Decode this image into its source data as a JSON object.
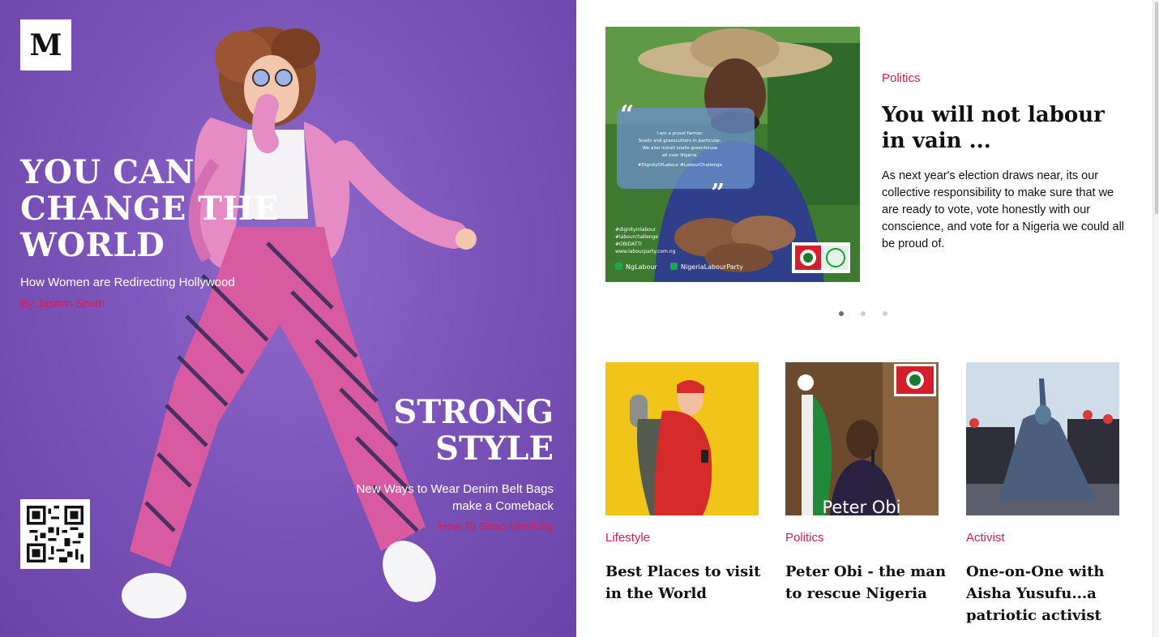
{
  "brand": {
    "logo_letter": "M"
  },
  "hero": {
    "headline_lines": [
      "YOU CAN",
      "CHANGE THE",
      "WORLD"
    ],
    "subheadline": "How Women are Redirecting Hollywood",
    "byline": "By Jasmin Smith",
    "secondary": {
      "title_lines": [
        "STRONG",
        "STYLE"
      ],
      "subheadline_lines": [
        "New Ways to Wear Denim Belt Bags",
        "make a Comeback"
      ],
      "link": "How To Shop Mindfully"
    }
  },
  "featured": {
    "category": "Politics",
    "title": "You will not labour in vain ...",
    "excerpt": "As next year's election draws near, its our collective responsibility to make sure that we are ready to vote, vote honestly with our conscience, and vote for a Nigeria we could all be proud of.",
    "image": {
      "quote_lines": [
        "I am a proud farmer.",
        "Snails and grasscutters in particular,",
        "We also install snails greenhouse",
        "all over Nigeria.",
        "#DignityOfLabour #LabourChallenge"
      ],
      "hashtags": [
        "#dignityinlabour",
        "#labourchallenge",
        "#OBIDATTI",
        "www.labourparty.com.ng"
      ],
      "social": [
        "NgLabour",
        "NigeriaLabourParty"
      ]
    }
  },
  "carousel": {
    "slide_count": 3,
    "active_index": 0
  },
  "cards": [
    {
      "category": "Lifestyle",
      "title": "Best Places to visit in the World"
    },
    {
      "category": "Politics",
      "title": "Peter Obi - the man to rescue Nigeria",
      "image_caption": "Peter Obi"
    },
    {
      "category": "Activist",
      "title": "One-on-One with Aisha Yusufu...a patriotic activist"
    }
  ],
  "colors": {
    "accent": "#e0194e",
    "hero_bg": "#7c55bb",
    "text": "#111111"
  }
}
